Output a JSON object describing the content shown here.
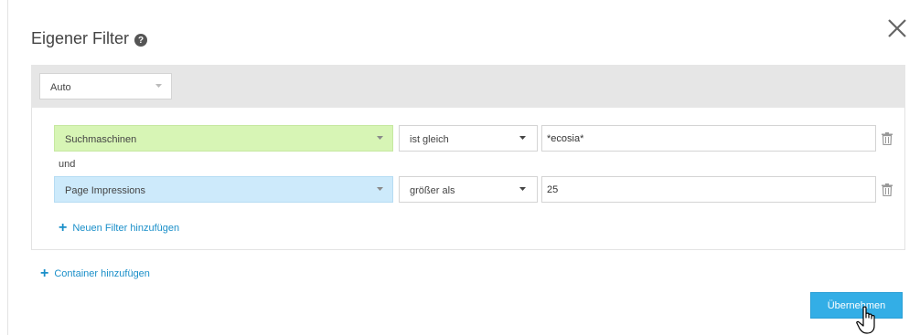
{
  "dialog": {
    "title": "Eigener Filter",
    "help_icon": "question-circle-icon",
    "close_icon": "close-x-icon"
  },
  "auto_bar": {
    "select_value": "Auto"
  },
  "filters": [
    {
      "dimension": "Suchmaschinen",
      "dimension_color": "#d7f5b5",
      "operator": "ist gleich",
      "value": "*ecosia*"
    },
    {
      "dimension": "Page Impressions",
      "dimension_color": "#cdeafb",
      "operator": "größer als",
      "value": "25"
    }
  ],
  "connector": "und",
  "add_filter_label": "Neuen Filter hinzufügen",
  "add_container_label": "Container hinzufügen",
  "apply_label": "Übernehmen",
  "colors": {
    "accent": "#33aee6",
    "link": "#1a8fc9",
    "bar_bg": "#e6e6e6"
  }
}
